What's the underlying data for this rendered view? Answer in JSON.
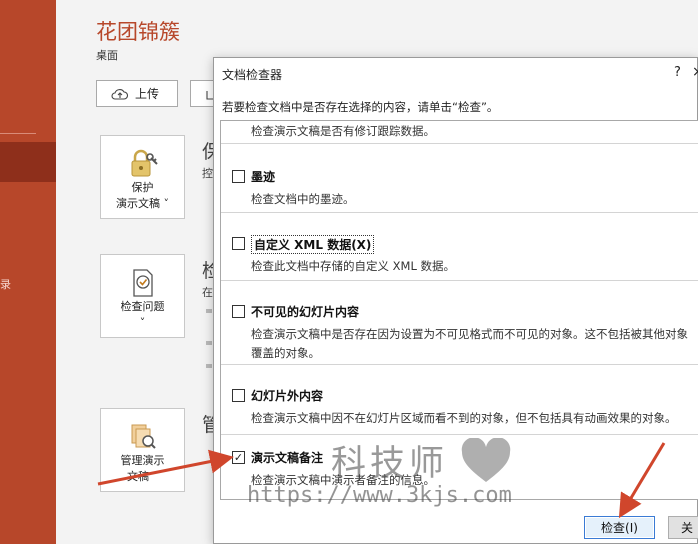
{
  "backstage": {
    "sidebar_edge_text": "录",
    "doc_title": "花团锦簇",
    "doc_location": "桌面",
    "toolbar": {
      "upload_label": "上传"
    },
    "features": [
      {
        "tile_line1": "保护",
        "tile_line2": "演示文稿",
        "heading": "保",
        "sub": "控"
      },
      {
        "tile_line1": "检查问题",
        "tile_line2": "",
        "heading": "检",
        "sub": "在"
      },
      {
        "tile_line1": "管理演示",
        "tile_line2": "文稿",
        "heading": "管",
        "sub": ""
      }
    ]
  },
  "dialog": {
    "title": "文档检查器",
    "help": "?",
    "close": "×",
    "intro": "若要检查文档中是否存在选择的内容，请单击“检查”。",
    "items": [
      {
        "name": "",
        "checked": false,
        "desc": "检查演示文稿是否有修订跟踪数据。"
      },
      {
        "name": "墨迹",
        "checked": false,
        "desc": "检查文档中的墨迹。"
      },
      {
        "name": "自定义 XML 数据(X)",
        "checked": false,
        "desc": "检查此文档中存储的自定义 XML 数据。"
      },
      {
        "name": "不可见的幻灯片内容",
        "checked": false,
        "desc": "检查演示文稿中是否存在因为设置为不可见格式而不可见的对象。这不包括被其他对象覆盖的对象。"
      },
      {
        "name": "幻灯片外内容",
        "checked": false,
        "desc": "检查演示文稿中因不在幻灯片区域而看不到的对象，但不包括具有动画效果的对象。"
      },
      {
        "name": "演示文稿备注",
        "checked": true,
        "desc": "检查演示文稿中演示者备注的信息。"
      }
    ],
    "inspect_button": "检查(I)",
    "close_button": "关"
  },
  "watermark": {
    "brand": "科技师",
    "url": "https://www.3kjs.com"
  },
  "colors": {
    "accent": "#b7472a",
    "arrow": "#d0462c",
    "focus": "#3a7bd5"
  }
}
